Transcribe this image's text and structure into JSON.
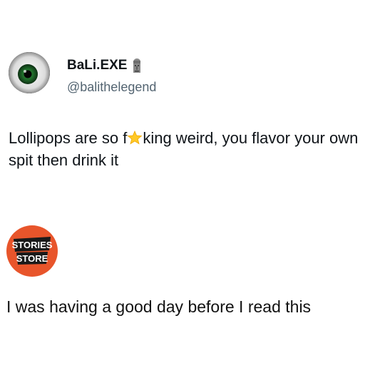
{
  "tweet": {
    "author": {
      "display_name": "BaLi.EXE",
      "handle": "@balithelegend",
      "badge_icon": "moai-icon",
      "avatar_icon": "green-eye-avatar"
    },
    "text": {
      "part1": "Lollipops are so f",
      "censor": "u",
      "censor_icon": "star-icon",
      "part2": "king weird, you flavor your own spit then drink it"
    }
  },
  "reply": {
    "logo": {
      "line1": "STORIES",
      "line2": "STORE",
      "color": "#e8552b"
    },
    "caption": "I was having a good day before I read this"
  }
}
